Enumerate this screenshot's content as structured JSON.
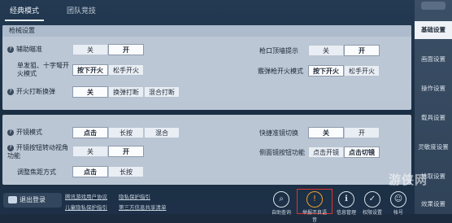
{
  "tabs": {
    "classic": "经典模式",
    "team": "团队竞技"
  },
  "section1": {
    "title": "枪械设置",
    "rows": {
      "aim_assist": {
        "label": "辅助瞄准",
        "options": [
          "关",
          "开"
        ],
        "selected": 1
      },
      "single_shot": {
        "label": "单发狙、十字弩开火模式",
        "options": [
          "按下开火",
          "松手开火"
        ],
        "selected": 0
      },
      "fire_switch": {
        "label": "开火打断换弹",
        "options": [
          "关",
          "换弹打断",
          "混合打断"
        ],
        "selected": 0
      },
      "muzzle_hint": {
        "label": "枪口顶墙提示",
        "options": [
          "关",
          "开"
        ],
        "selected": 1
      },
      "shotgun_mode": {
        "label": "霰弹枪开火模式",
        "options": [
          "按下开火",
          "松手开火"
        ],
        "selected": 0
      }
    }
  },
  "section2": {
    "rows": {
      "scope_mode": {
        "label": "开镜模式",
        "options": [
          "点击",
          "长按",
          "混合"
        ],
        "selected": 0
      },
      "scope_btn": {
        "label": "开镜按钮转动视角功能",
        "options": [
          "关",
          "开"
        ],
        "selected": 1
      },
      "adjust_focus": {
        "label": "调整焦距方式",
        "options": [
          "点击",
          "长按"
        ],
        "selected": 0
      },
      "quick_switch": {
        "label": "快捷准镜切换",
        "options": [
          "关",
          "开"
        ],
        "selected": 0
      },
      "side_scope": {
        "label": "侧面镜按钮功能",
        "options": [
          "点击开镜",
          "点击切镜"
        ],
        "selected": 1
      }
    }
  },
  "rail": {
    "items": [
      "基础设置",
      "画面设置",
      "操作设置",
      "载具设置",
      "灵敏度设置",
      "拾取设置",
      "效果设置"
    ],
    "active": 0
  },
  "bottom": {
    "logout": "退出登录",
    "links": [
      "腾讯游戏用户协议",
      "隐私保护指引",
      "儿童隐私保护指引",
      "第三方信息共享清单"
    ],
    "buttons": [
      "自助查询",
      "举报不良语音",
      "信息管理",
      "权限设置",
      "帐号"
    ],
    "watermark": "游侠网"
  },
  "colors": {
    "report_highlight": "#e0332e",
    "warn_icon": "#f0a030"
  }
}
